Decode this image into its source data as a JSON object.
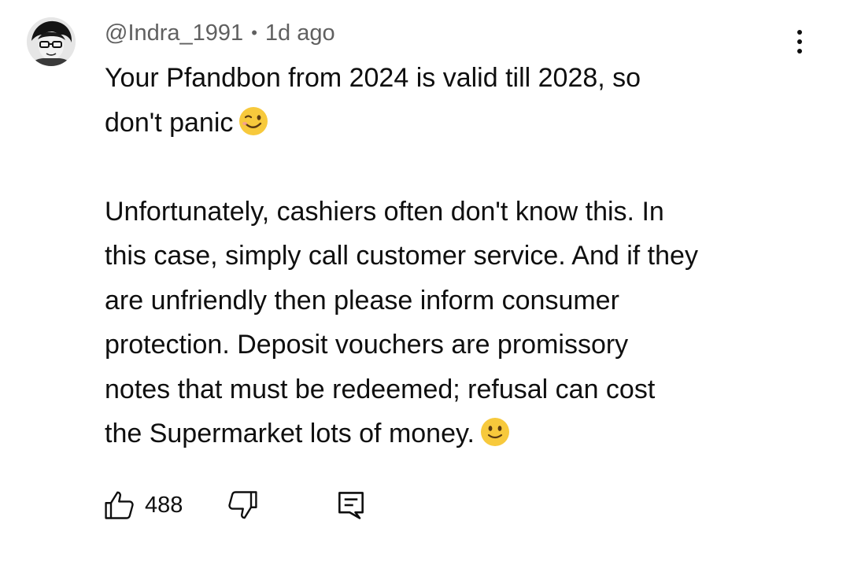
{
  "comment": {
    "author": "@Indra_1991",
    "separator": "•",
    "time": "1d ago",
    "paragraph1_line1": "Your Pfandbon  from 2024 is valid till 2028, so",
    "paragraph1_line2": "don't panic",
    "paragraph2_lines": [
      "Unfortunately, cashiers often don't know this. In",
      "this case, simply call customer service. And if they",
      "are unfriendly then please inform consumer",
      "protection. Deposit vouchers are promissory",
      "notes that must be redeemed; refusal can cost",
      "the Supermarket lots of money."
    ]
  },
  "actions": {
    "like_count": "488"
  },
  "icons": {
    "avatar": "avatar-image",
    "menu": "more-vert-icon",
    "wink_emoji": "winking-face-emoji",
    "smile_emoji": "slightly-smiling-face-emoji",
    "like": "thumbs-up-icon",
    "dislike": "thumbs-down-icon",
    "reply": "reply-comment-icon"
  },
  "colors": {
    "text": "#0f0f0f",
    "meta": "#606060",
    "background": "#ffffff",
    "emoji": "#f7c93c"
  }
}
